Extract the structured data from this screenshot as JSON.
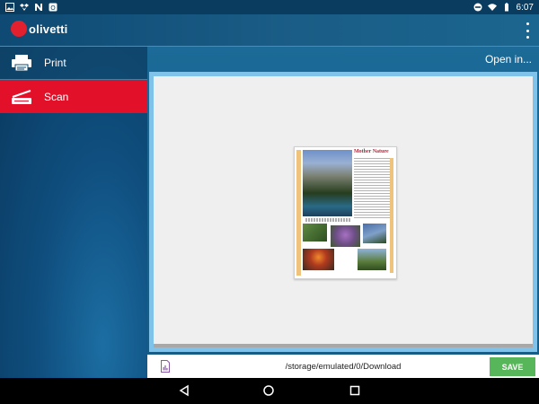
{
  "status_bar": {
    "time": "6:07"
  },
  "app_bar": {
    "logo_text": "olivetti"
  },
  "sidebar": {
    "items": [
      {
        "label": "Print",
        "icon": "printer-icon",
        "active": false
      },
      {
        "label": "Scan",
        "icon": "scanner-icon",
        "active": true
      }
    ]
  },
  "main": {
    "open_in_label": "Open in...",
    "thumbnail_title": "Mother Nature"
  },
  "save_bar": {
    "path": "/storage/emulated/0/Download",
    "save_label": "SAVE"
  },
  "colors": {
    "accent_red": "#e3102a",
    "save_green": "#58b65a",
    "frame_blue": "#7fc3ea"
  }
}
